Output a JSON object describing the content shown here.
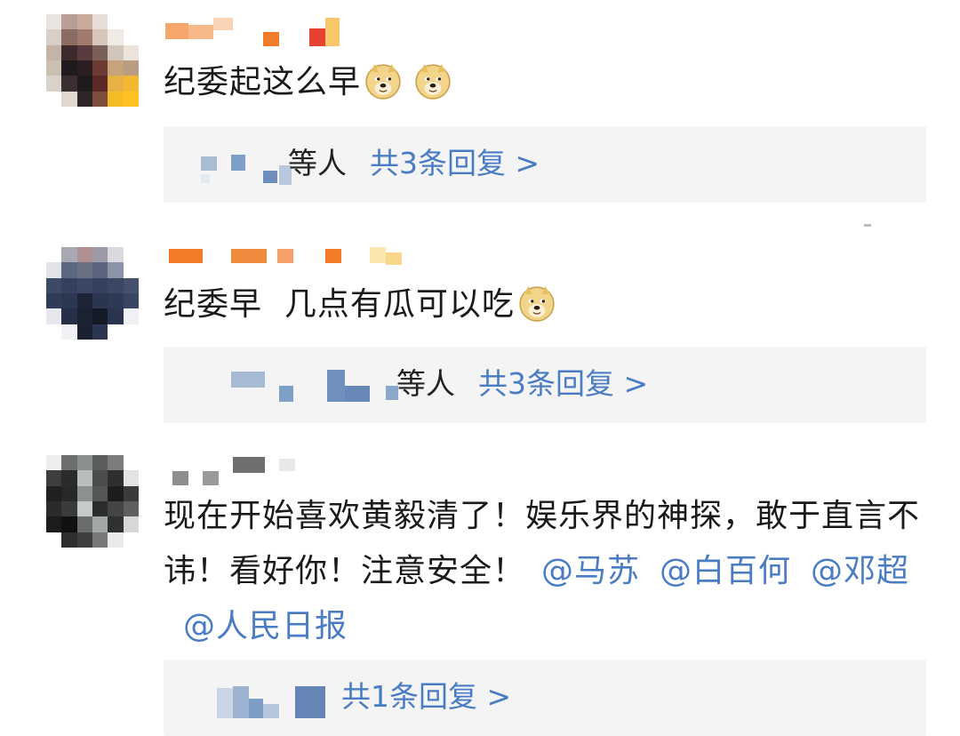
{
  "comments": [
    {
      "text": "纪委起这么早",
      "emojis": [
        "doge-icon",
        "doge-icon"
      ],
      "reply_suffix": "等人",
      "reply_count": "共3条回复 >"
    },
    {
      "text": "纪委早  几点有瓜可以吃",
      "emojis": [
        "doge-icon"
      ],
      "reply_suffix": "等人",
      "reply_count": "共3条回复 >"
    },
    {
      "text_plain": "现在开始喜欢黄毅清了！娱乐界的神探，敢于直言不讳！看好你！注意安全！",
      "mentions": [
        "@马苏",
        "@白百何",
        "@邓超",
        "@人民日报"
      ],
      "reply_count": "共1条回复 >"
    }
  ],
  "colors": {
    "link": "#4a7cc4",
    "reply_bg": "#f4f4f4",
    "text": "#1a1a1a"
  }
}
